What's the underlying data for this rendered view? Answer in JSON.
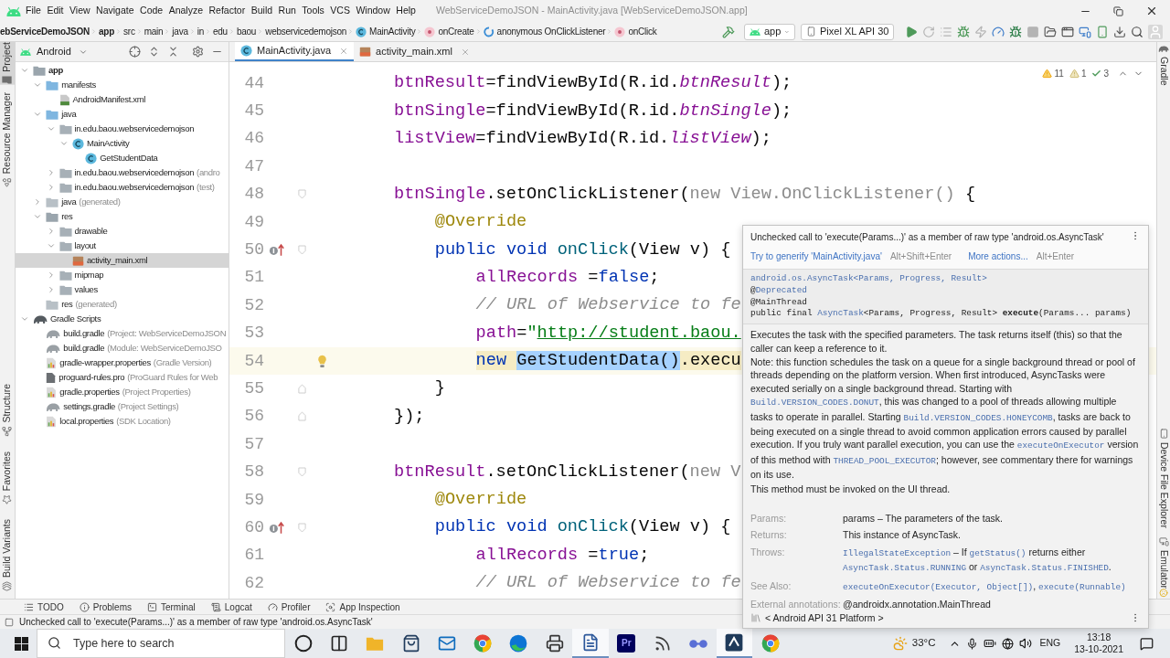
{
  "menu_bar": {
    "items": [
      "File",
      "Edit",
      "View",
      "Navigate",
      "Code",
      "Analyze",
      "Refactor",
      "Build",
      "Run",
      "Tools",
      "VCS",
      "Window",
      "Help"
    ],
    "title": "WebServiceDemoJSON - MainActivity.java [WebServiceDemoJSON.app]"
  },
  "navigation_bar": {
    "breadcrumbs": [
      {
        "text": "ebServiceDemoJSON",
        "kind": "project"
      },
      {
        "text": "app",
        "kind": "module"
      },
      {
        "text": "src",
        "kind": "folder"
      },
      {
        "text": "main",
        "kind": "folder"
      },
      {
        "text": "java",
        "kind": "folder"
      },
      {
        "text": "in",
        "kind": "folder"
      },
      {
        "text": "edu",
        "kind": "folder"
      },
      {
        "text": "baou",
        "kind": "folder"
      },
      {
        "text": "webservicedemojson",
        "kind": "folder"
      },
      {
        "text": "MainActivity",
        "kind": "class"
      },
      {
        "text": "onCreate",
        "kind": "method"
      },
      {
        "text": "anonymous OnClickListener",
        "kind": "lambda"
      },
      {
        "text": "onClick",
        "kind": "method"
      }
    ],
    "build": {
      "kind": "build",
      "disabled": false
    },
    "run_config": "app",
    "device": "Pixel XL API 30",
    "actions": [
      {
        "kind": "run",
        "disabled": false
      },
      {
        "kind": "rerun",
        "disabled": true
      },
      {
        "kind": "apply_changes",
        "disabled": true
      },
      {
        "kind": "debug",
        "disabled": false
      },
      {
        "kind": "apply_code",
        "disabled": true
      },
      {
        "kind": "profile",
        "disabled": false
      },
      {
        "kind": "attach_debugger",
        "disabled": false
      },
      {
        "kind": "stop",
        "disabled": true
      },
      {
        "kind": "device_manager",
        "disabled": false
      },
      {
        "kind": "layout_inspector",
        "disabled": false
      },
      {
        "kind": "avd_manager",
        "disabled": false
      },
      {
        "kind": "device_mirror",
        "disabled": false
      },
      {
        "kind": "sdk_manager",
        "disabled": false
      },
      {
        "kind": "search",
        "disabled": false
      },
      {
        "kind": "account",
        "disabled": false
      }
    ]
  },
  "left_tool_strip": {
    "top": [
      {
        "label": "Project",
        "kind": "project",
        "selected": true
      },
      {
        "label": "Resource Manager",
        "kind": "resources",
        "selected": false
      }
    ],
    "bottom": [
      {
        "label": "Structure",
        "kind": "structure",
        "selected": false
      },
      {
        "label": "Favorites",
        "kind": "favorites",
        "selected": false
      },
      {
        "label": "Build Variants",
        "kind": "variants",
        "selected": false
      }
    ]
  },
  "project_panel": {
    "view": "Android",
    "tree": [
      {
        "name": "app",
        "kind": "module",
        "expanded": true,
        "selected": false,
        "children": [
          {
            "name": "manifests",
            "kind": "source_folder",
            "expanded": true,
            "selected": false,
            "children": [
              {
                "name": "AndroidManifest.xml",
                "kind": "manifest",
                "selected": false
              }
            ]
          },
          {
            "name": "java",
            "kind": "source_folder",
            "expanded": true,
            "selected": false,
            "children": [
              {
                "name": "in.edu.baou.webservicedemojson",
                "kind": "package",
                "expanded": true,
                "selected": false,
                "children": [
                  {
                    "name": "MainActivity",
                    "kind": "class",
                    "expanded": true,
                    "selected": false,
                    "children": [
                      {
                        "name": "GetStudentData",
                        "kind": "class",
                        "selected": false
                      }
                    ]
                  }
                ]
              },
              {
                "name": "in.edu.baou.webservicedemojson",
                "suffix": "(andro",
                "kind": "package",
                "expanded": false,
                "selected": false
              },
              {
                "name": "in.edu.baou.webservicedemojson",
                "suffix": "(test)",
                "kind": "package",
                "expanded": false,
                "selected": false
              }
            ]
          },
          {
            "name": "java",
            "suffix": "(generated)",
            "kind": "generated",
            "expanded": false,
            "selected": false
          },
          {
            "name": "res",
            "kind": "folder",
            "expanded": true,
            "selected": false,
            "children": [
              {
                "name": "drawable",
                "kind": "package",
                "expanded": false,
                "selected": false
              },
              {
                "name": "layout",
                "kind": "package",
                "expanded": true,
                "selected": false,
                "children": [
                  {
                    "name": "activity_main.xml",
                    "kind": "layout",
                    "selected": true
                  }
                ]
              },
              {
                "name": "mipmap",
                "kind": "package",
                "expanded": false,
                "selected": false
              },
              {
                "name": "values",
                "kind": "package",
                "expanded": false,
                "selected": false
              }
            ]
          },
          {
            "name": "res",
            "suffix": "(generated)",
            "kind": "generated",
            "selected": false
          }
        ]
      },
      {
        "name": "Gradle Scripts",
        "kind": "gradle_group",
        "expanded": true,
        "selected": false,
        "children": [
          {
            "name": "build.gradle",
            "suffix": "(Project: WebServiceDemoJSON",
            "kind": "gradle",
            "selected": false
          },
          {
            "name": "build.gradle",
            "suffix": "(Module: WebServiceDemoJSO",
            "kind": "gradle",
            "selected": false
          },
          {
            "name": "gradle-wrapper.properties",
            "suffix": "(Gradle Version)",
            "kind": "properties",
            "selected": false
          },
          {
            "name": "proguard-rules.pro",
            "suffix": "(ProGuard Rules for Web",
            "kind": "pro",
            "selected": false
          },
          {
            "name": "gradle.properties",
            "suffix": "(Project Properties)",
            "kind": "properties",
            "selected": false
          },
          {
            "name": "settings.gradle",
            "suffix": "(Project Settings)",
            "kind": "gradle",
            "selected": false
          },
          {
            "name": "local.properties",
            "suffix": "(SDK Location)",
            "kind": "properties",
            "selected": false
          }
        ]
      }
    ]
  },
  "editor": {
    "tabs": [
      {
        "label": "MainActivity.java",
        "kind": "class",
        "selected": true
      },
      {
        "label": "activity_main.xml",
        "kind": "layout",
        "selected": false
      }
    ],
    "inspections": [
      {
        "kind": "warning",
        "count": "11"
      },
      {
        "kind": "weak_warning",
        "count": "1"
      },
      {
        "kind": "typo",
        "count": "3"
      }
    ],
    "lines": [
      {
        "number": "44",
        "current": false,
        "tokens": [
          {
            "text": "btnResult",
            "kind": "field"
          },
          {
            "text": "=findViewById(R.id.",
            "kind": "plain"
          },
          {
            "text": "btnResult",
            "kind": "static_field"
          },
          {
            "text": ");",
            "kind": "plain"
          }
        ]
      },
      {
        "number": "45",
        "current": false,
        "tokens": [
          {
            "text": "btnSingle",
            "kind": "field"
          },
          {
            "text": "=findViewById(R.id.",
            "kind": "plain"
          },
          {
            "text": "btnSingle",
            "kind": "static_field"
          },
          {
            "text": ");",
            "kind": "plain"
          }
        ]
      },
      {
        "number": "46",
        "current": false,
        "tokens": [
          {
            "text": "listView",
            "kind": "field"
          },
          {
            "text": "=findViewById(R.id.",
            "kind": "plain"
          },
          {
            "text": "listView",
            "kind": "static_field"
          },
          {
            "text": ");",
            "kind": "plain"
          }
        ]
      },
      {
        "number": "47",
        "current": false
      },
      {
        "number": "48",
        "current": false,
        "gutter": [
          {
            "kind": "fold_start"
          }
        ],
        "tokens": [
          {
            "text": "btnSingle",
            "kind": "field"
          },
          {
            "text": ".setOnClickListener(",
            "kind": "plain"
          },
          {
            "text": "new View.OnClickListener()",
            "kind": "unused"
          },
          {
            "text": " {",
            "kind": "plain"
          }
        ],
        "children": [
          {
            "number": "49",
            "current": false,
            "tokens": [
              {
                "text": "@Override",
                "kind": "annotation"
              }
            ]
          },
          {
            "number": "50",
            "current": false,
            "gutter": [
              {
                "kind": "implements"
              },
              {
                "kind": "fold_start"
              }
            ],
            "tokens": [
              {
                "text": "public void ",
                "kind": "keyword"
              },
              {
                "text": "onClick",
                "kind": "method"
              },
              {
                "text": "(View v) {",
                "kind": "plain"
              }
            ],
            "children": [
              {
                "number": "51",
                "current": false,
                "tokens": [
                  {
                    "text": "allRecords",
                    "kind": "field"
                  },
                  {
                    "text": " =",
                    "kind": "plain"
                  },
                  {
                    "text": "false",
                    "kind": "keyword"
                  },
                  {
                    "text": ";",
                    "kind": "plain"
                  }
                ]
              },
              {
                "number": "52",
                "current": false,
                "tokens": [
                  {
                    "text": "// URL of Webservice to fe",
                    "kind": "comment"
                  }
                ]
              },
              {
                "number": "53",
                "current": false,
                "tokens": [
                  {
                    "text": "path",
                    "kind": "field"
                  },
                  {
                    "text": "=",
                    "kind": "plain"
                  },
                  {
                    "text": "\"",
                    "kind": "string"
                  },
                  {
                    "text": "http://student.baou.",
                    "kind": "url"
                  }
                ]
              },
              {
                "number": "54",
                "current": true,
                "gutter": [
                  {
                    "kind": "bulb"
                  }
                ],
                "tokens": [
                  {
                    "text": "new ",
                    "kind": "keyword",
                    "warning": true,
                    "selected": false
                  },
                  {
                    "text": "GetStudentData()",
                    "kind": "plain",
                    "selected": true
                  },
                  {
                    "text": ".execu",
                    "kind": "plain",
                    "warning": true,
                    "selected": false
                  }
                ]
              }
            ]
          },
          {
            "number": "55",
            "current": false,
            "gutter": [
              {
                "kind": "fold_end"
              }
            ],
            "tokens": [
              {
                "text": "}",
                "kind": "plain"
              }
            ]
          }
        ]
      },
      {
        "number": "56",
        "current": false,
        "gutter": [
          {
            "kind": "fold_end"
          }
        ],
        "tokens": [
          {
            "text": "});",
            "kind": "plain"
          }
        ]
      },
      {
        "number": "57",
        "current": false
      },
      {
        "number": "58",
        "current": false,
        "gutter": [
          {
            "kind": "fold_start"
          }
        ],
        "tokens": [
          {
            "text": "btnResult",
            "kind": "field"
          },
          {
            "text": ".setOnClickListener(",
            "kind": "plain"
          },
          {
            "text": "new V",
            "kind": "unused"
          }
        ],
        "children": [
          {
            "number": "59",
            "current": false,
            "tokens": [
              {
                "text": "@Override",
                "kind": "annotation"
              }
            ]
          },
          {
            "number": "60",
            "current": false,
            "gutter": [
              {
                "kind": "implements"
              },
              {
                "kind": "fold_start"
              }
            ],
            "tokens": [
              {
                "text": "public void ",
                "kind": "keyword"
              },
              {
                "text": "onClick",
                "kind": "method"
              },
              {
                "text": "(View v) {",
                "kind": "plain"
              }
            ],
            "children": [
              {
                "number": "61",
                "current": false,
                "tokens": [
                  {
                    "text": "allRecords",
                    "kind": "field"
                  },
                  {
                    "text": " =",
                    "kind": "plain"
                  },
                  {
                    "text": "true",
                    "kind": "keyword"
                  },
                  {
                    "text": ";",
                    "kind": "plain"
                  }
                ]
              },
              {
                "number": "62",
                "current": false,
                "tokens": [
                  {
                    "text": "// URL of Webservice to fe",
                    "kind": "comment"
                  }
                ]
              }
            ]
          }
        ]
      }
    ]
  },
  "right_tool_strip": [
    {
      "label": "Gradle",
      "kind": "gradle",
      "selected": false
    },
    {
      "label": "Device File Explorer",
      "kind": "device_files",
      "selected": false
    },
    {
      "label": "Emulator",
      "kind": "emulator",
      "selected": false
    }
  ],
  "popup": {
    "problem": "Unchecked call to 'execute(Params...)' as a member of raw type 'android.os.AsyncTask'",
    "actions": [
      {
        "label": "Try to generify 'MainActivity.java'",
        "shortcut": "Alt+Shift+Enter"
      },
      {
        "label": "More actions...",
        "shortcut": "Alt+Enter"
      }
    ],
    "signature": [
      [
        {
          "text": "android.os.AsyncTask<Params, Progress, Result>",
          "kind": "link"
        }
      ],
      [
        {
          "text": "@",
          "kind": "code"
        },
        {
          "text": "Deprecated",
          "kind": "link"
        }
      ],
      [
        {
          "text": "@MainThread",
          "kind": "code"
        }
      ],
      [
        {
          "text": "public final ",
          "kind": "code"
        },
        {
          "text": "AsyncTask",
          "kind": "link"
        },
        {
          "text": "<Params, Progress, Result> ",
          "kind": "code"
        },
        {
          "text": "execute",
          "kind": "bold"
        },
        {
          "text": "(Params... params)",
          "kind": "code"
        }
      ]
    ],
    "paragraphs": [
      [
        {
          "text": "Executes the task with the specified parameters. The task returns itself (this) so that the caller can keep a reference to it.",
          "kind": "text"
        }
      ],
      [
        {
          "text": "Note: this function schedules the task on a queue for a single background thread or pool of threads depending on the platform version. When first introduced, AsyncTasks were executed serially on a single background thread. Starting with ",
          "kind": "text"
        },
        {
          "text": "Build.VERSION_CODES.DONUT",
          "kind": "link"
        },
        {
          "text": ", this was changed to a pool of threads allowing multiple tasks to operate in parallel. Starting ",
          "kind": "text"
        },
        {
          "text": "Build.VERSION_CODES.HONEYCOMB",
          "kind": "link"
        },
        {
          "text": ", tasks are back to being executed on a single thread to avoid common application errors caused by parallel execution. If you truly want parallel execution, you can use the ",
          "kind": "text"
        },
        {
          "text": "executeOnExecutor",
          "kind": "link"
        },
        {
          "text": " version of this method with ",
          "kind": "text"
        },
        {
          "text": "THREAD_POOL_EXECUTOR",
          "kind": "link"
        },
        {
          "text": "; however, see commentary there for warnings on its use.",
          "kind": "text"
        }
      ],
      [
        {
          "text": "This method must be invoked on the UI thread.",
          "kind": "text"
        }
      ]
    ],
    "sections": [
      {
        "label": "Params:",
        "value": [
          {
            "text": "params – The parameters of the task.",
            "kind": "text"
          }
        ]
      },
      {
        "label": "Returns:",
        "value": [
          {
            "text": "This instance of AsyncTask.",
            "kind": "text"
          }
        ]
      },
      {
        "label": "Throws:",
        "value": [
          {
            "text": "IllegalStateException",
            "kind": "link"
          },
          {
            "text": " – If ",
            "kind": "text"
          },
          {
            "text": "getStatus()",
            "kind": "link"
          },
          {
            "text": " returns either ",
            "kind": "text"
          },
          {
            "text": "AsyncTask.Status.RUNNING",
            "kind": "link"
          },
          {
            "text": " or ",
            "kind": "text"
          },
          {
            "text": "AsyncTask.Status.FINISHED",
            "kind": "link"
          },
          {
            "text": ".",
            "kind": "text"
          }
        ]
      },
      {
        "label": "See Also:",
        "value": [
          {
            "text": "executeOnExecutor(Executor, Object[])",
            "kind": "link"
          },
          {
            "text": ", ",
            "kind": "text"
          },
          {
            "text": "execute(Runnable)",
            "kind": "link"
          }
        ]
      },
      {
        "label": "External annotations:",
        "value": [
          {
            "text": "@androidx.annotation.MainThread",
            "kind": "text"
          }
        ]
      }
    ],
    "footer": "< Android API 31 Platform >"
  },
  "bottom_tool_tabs": [
    {
      "label": "TODO",
      "kind": "todo",
      "selected": false
    },
    {
      "label": "Problems",
      "kind": "problems",
      "selected": false
    },
    {
      "label": "Terminal",
      "kind": "terminal",
      "selected": false
    },
    {
      "label": "Logcat",
      "kind": "logcat",
      "selected": false
    },
    {
      "label": "Profiler",
      "kind": "profiler",
      "selected": false
    },
    {
      "label": "App Inspection",
      "kind": "inspection",
      "selected": false
    }
  ],
  "status_bar": {
    "message": "Unchecked call to 'execute(Params...)' as a member of raw type 'android.os.AsyncTask'"
  },
  "taskbar": {
    "search_placeholder": "Type here to search",
    "apps": [
      {
        "kind": "cortana",
        "selected": false
      },
      {
        "kind": "task_view",
        "selected": false
      },
      {
        "kind": "explorer",
        "selected": false
      },
      {
        "kind": "store",
        "selected": false
      },
      {
        "kind": "mail",
        "selected": false
      },
      {
        "kind": "chrome",
        "selected": false
      },
      {
        "kind": "edge",
        "selected": false
      },
      {
        "kind": "scanner",
        "selected": false
      },
      {
        "kind": "word",
        "selected": true
      },
      {
        "kind": "premiere",
        "label": "Pr",
        "selected": false
      },
      {
        "kind": "feed",
        "selected": false
      },
      {
        "kind": "glasses",
        "selected": false
      },
      {
        "kind": "studio",
        "selected": true
      },
      {
        "kind": "chrome",
        "selected": false
      }
    ],
    "weather": "33°C",
    "language": "ENG",
    "time": "13:18",
    "date": "13-10-2021"
  }
}
